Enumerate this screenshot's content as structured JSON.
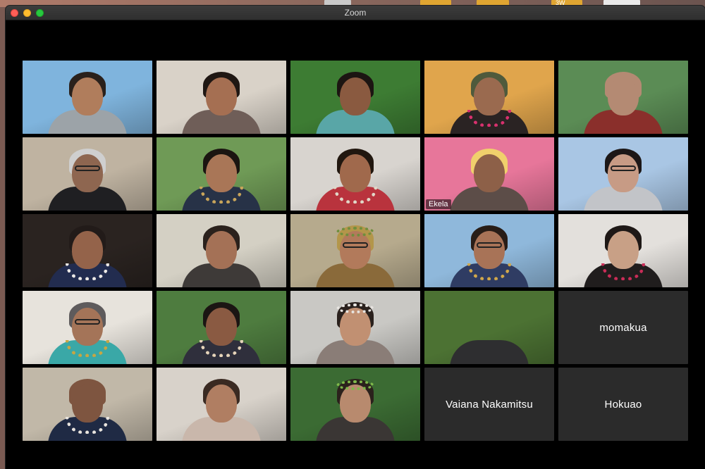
{
  "window": {
    "title": "Zoom"
  },
  "desktop": {
    "badge_text": "3W"
  },
  "participants": [
    {
      "label": "",
      "bg": "#7fb4dd",
      "skin": "#b07d5c",
      "hair": "#2a211c",
      "shirt": "#9ca3a8"
    },
    {
      "label": "",
      "bg": "#d9d2c8",
      "skin": "#a56f52",
      "hair": "#1f1713",
      "shirt": "#6f5e58"
    },
    {
      "label": "",
      "bg": "#3d7c33",
      "skin": "#8a5a40",
      "hair": "#1c1512",
      "shirt": "#59a6a7"
    },
    {
      "label": "",
      "bg": "#e0a54c",
      "skin": "#9a6a4f",
      "hair": "#4f5a3c",
      "shirt": "#2a2323",
      "lei": "#d8316e"
    },
    {
      "label": "",
      "bg": "#5b8c55",
      "skin": "#b48a73",
      "hair": "#b48a73",
      "shirt": "#8a2f2b"
    },
    {
      "label": "",
      "bg": "#bfb3a1",
      "skin": "#8e6650",
      "hair": "#cfcfcf",
      "shirt": "#1f1f22",
      "glasses": true
    },
    {
      "label": "",
      "bg": "#6f9a56",
      "skin": "#a97657",
      "hair": "#1b1511",
      "shirt": "#273247",
      "lei": "#c9a55a"
    },
    {
      "label": "",
      "bg": "#d8d4cf",
      "skin": "#a0694c",
      "hair": "#21170f",
      "shirt": "#b9333d",
      "lei": "#e1d7c8"
    },
    {
      "label": "Ekela",
      "bg": "#e7769a",
      "skin": "#8d6048",
      "hair": "#f0d06c",
      "shirt": "#5c4d48",
      "active": true
    },
    {
      "label": "",
      "bg": "#a9c6e4",
      "skin": "#c79b85",
      "hair": "#1c1717",
      "shirt": "#c2c4c8",
      "glasses": true
    },
    {
      "label": "",
      "bg": "#2a2320",
      "skin": "#94634a",
      "hair": "#221b19",
      "shirt": "#222c4f",
      "lei": "#ece9e6"
    },
    {
      "label": "",
      "bg": "#d4d0c4",
      "skin": "#a47156",
      "hair": "#2a211c",
      "shirt": "#3e3a38"
    },
    {
      "label": "",
      "bg": "#b6aa8d",
      "skin": "#b27a5b",
      "hair": "#b3964a",
      "shirt": "#8a6a3a",
      "glasses": true,
      "crown": "#6f8e3d"
    },
    {
      "label": "",
      "bg": "#8fb8db",
      "skin": "#a87357",
      "hair": "#281d17",
      "shirt": "#2f3c63",
      "lei": "#d2a84a",
      "glasses": true
    },
    {
      "label": "",
      "bg": "#e3e0dc",
      "skin": "#c8a086",
      "hair": "#1e1816",
      "shirt": "#201d1d",
      "lei": "#c92c57"
    },
    {
      "label": "",
      "bg": "#e7e3dc",
      "skin": "#a47458",
      "hair": "#5e5b5c",
      "shirt": "#3aa8a7",
      "lei": "#c7a643",
      "glasses": true
    },
    {
      "label": "",
      "bg": "#4e7c3f",
      "skin": "#8a5a42",
      "hair": "#1b1513",
      "shirt": "#2f2f3c",
      "lei": "#e6d4ba"
    },
    {
      "label": "",
      "bg": "#c9c8c4",
      "skin": "#c19072",
      "hair": "#2a211d",
      "shirt": "#8a7d77",
      "crown": "#e7e4e0"
    },
    {
      "label": "",
      "bg": "#4c7233",
      "skin": "#5a5a58",
      "hair": "#3b3b3b",
      "shirt": "#2e2e30",
      "empty": true
    },
    {
      "label": "momakua",
      "nameOnly": true
    },
    {
      "label": "",
      "bg": "#c1b8a8",
      "skin": "#7e5540",
      "hair": "#7e5540",
      "shirt": "#1f2a44",
      "lei": "#e8e4de"
    },
    {
      "label": "",
      "bg": "#d8d2ca",
      "skin": "#b07e62",
      "hair": "#3a2a22",
      "shirt": "#c9b7ab"
    },
    {
      "label": "",
      "bg": "#3b6b33",
      "skin": "#b88a6e",
      "hair": "#2b211c",
      "shirt": "#3a3634",
      "crown": "#7fb84a"
    },
    {
      "label": "Vaiana Nakamitsu",
      "nameOnly": true
    },
    {
      "label": "Hokuao",
      "nameOnly": true
    }
  ]
}
